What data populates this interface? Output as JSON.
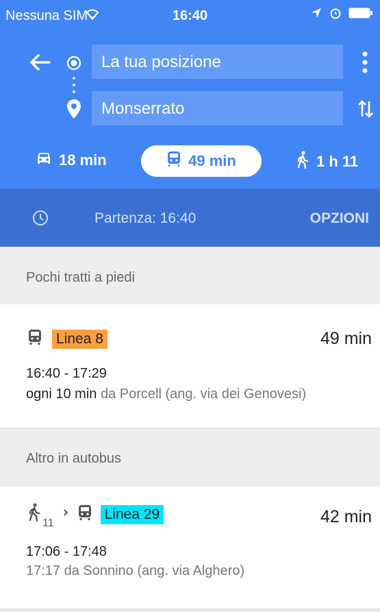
{
  "status_bar": {
    "carrier": "Nessuna SIM",
    "time": "16:40"
  },
  "route": {
    "origin": "La tua posizione",
    "destination": "Monserrato"
  },
  "modes": [
    {
      "icon": "car-icon",
      "label": "18 min"
    },
    {
      "icon": "transit-icon",
      "label": "49 min",
      "active": true
    },
    {
      "icon": "walk-icon",
      "label": "1 h 11"
    }
  ],
  "departure": {
    "label": "Partenza: 16:40",
    "options": "OPZIONI"
  },
  "sections": [
    {
      "title": "Pochi tratti a piedi",
      "option": {
        "line": "Linea 8",
        "line_color": "#ff9f40",
        "duration": "49 min",
        "times": "16:40 - 17:29",
        "freq_strong": "ogni 10 min",
        "freq_rest": " da Porcell (ang. via dei Genovesi)"
      }
    },
    {
      "title": "Altro in autobus",
      "option": {
        "walk_minutes": "11",
        "line": "Linea 29",
        "line_color": "#00e5ff",
        "duration": "42 min",
        "times": "17:06 - 17:48",
        "freq_rest": "17:17 da Sonnino (ang. via Alghero)"
      }
    }
  ],
  "colors": {
    "primary": "#4285f4",
    "departure_bar": "#3b6fd2",
    "background": "#eeeeee"
  }
}
